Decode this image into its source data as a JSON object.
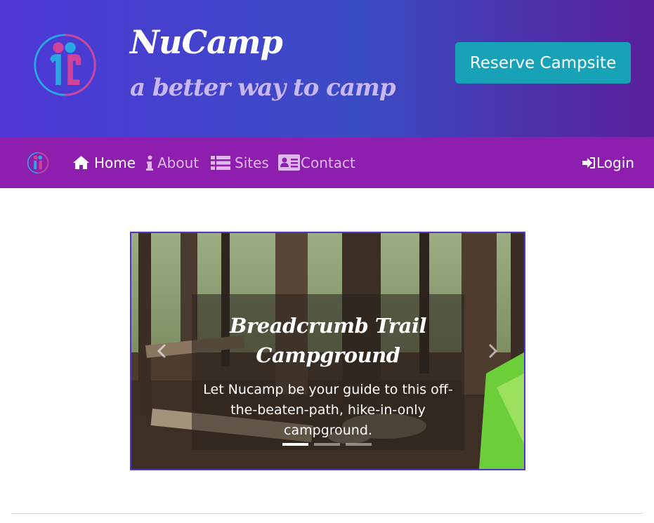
{
  "header": {
    "brand": "NuCamp",
    "tagline": "a better way to camp",
    "reserve_label": "Reserve Campsite",
    "logo_icon": "nucamp-logo-icon"
  },
  "nav": {
    "items": [
      {
        "label": "Home",
        "icon": "home-icon",
        "active": true
      },
      {
        "label": "About",
        "icon": "info-icon",
        "active": false
      },
      {
        "label": "Sites",
        "icon": "list-icon",
        "active": false
      },
      {
        "label": "Contact",
        "icon": "address-card-icon",
        "active": false
      }
    ],
    "login_label": "Login",
    "login_icon": "sign-in-icon"
  },
  "carousel": {
    "title": "Breadcrumb Trail Campground",
    "text": "Let Nucamp be your guide to this off-the-beaten-path, hike-in-only campground.",
    "slides": 3,
    "active_slide": 1
  },
  "colors": {
    "header_gradient_start": "#4e37d6",
    "header_gradient_end": "#5a1f9a",
    "navbar": "#8e1fae",
    "reserve_button": "#17a2b8",
    "carousel_border": "#5236c9"
  }
}
